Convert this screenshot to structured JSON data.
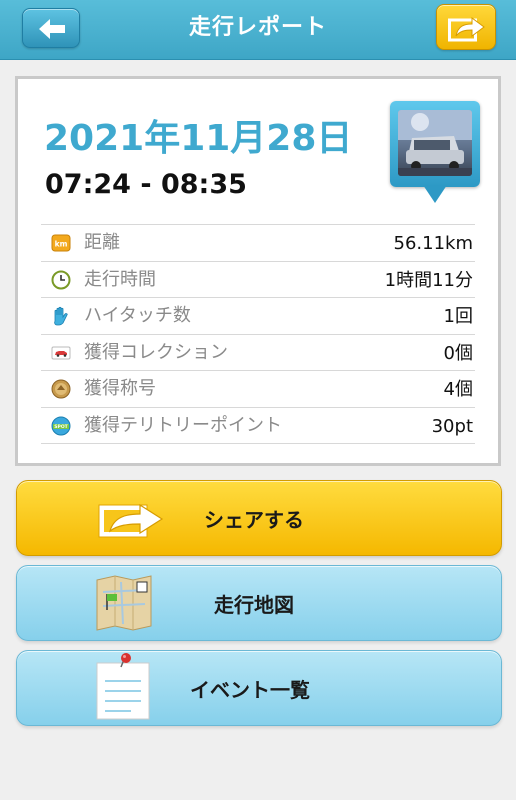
{
  "header": {
    "title": "走行レポート"
  },
  "report": {
    "date": "2021年11月28日",
    "time_range": "07:24 - 08:35",
    "stats": [
      {
        "icon": "distance-km-icon",
        "label": "距離",
        "value": "56.11km"
      },
      {
        "icon": "clock-icon",
        "label": "走行時間",
        "value": "1時間11分"
      },
      {
        "icon": "hand-icon",
        "label": "ハイタッチ数",
        "value": "1回"
      },
      {
        "icon": "car-card-icon",
        "label": "獲得コレクション",
        "value": "0個"
      },
      {
        "icon": "medal-icon",
        "label": "獲得称号",
        "value": "4個"
      },
      {
        "icon": "spot-icon",
        "label": "獲得テリトリーポイント",
        "value": "30pt"
      }
    ],
    "distance_icon_text": "km",
    "spot_icon_text": "SPOT"
  },
  "buttons": {
    "share": "シェアする",
    "map": "走行地図",
    "events": "イベント一覧"
  },
  "colors": {
    "header": "#4cb3d3",
    "date": "#3fa9cf",
    "share_button": "#f9c91a",
    "secondary_button": "#9fdcf1"
  }
}
